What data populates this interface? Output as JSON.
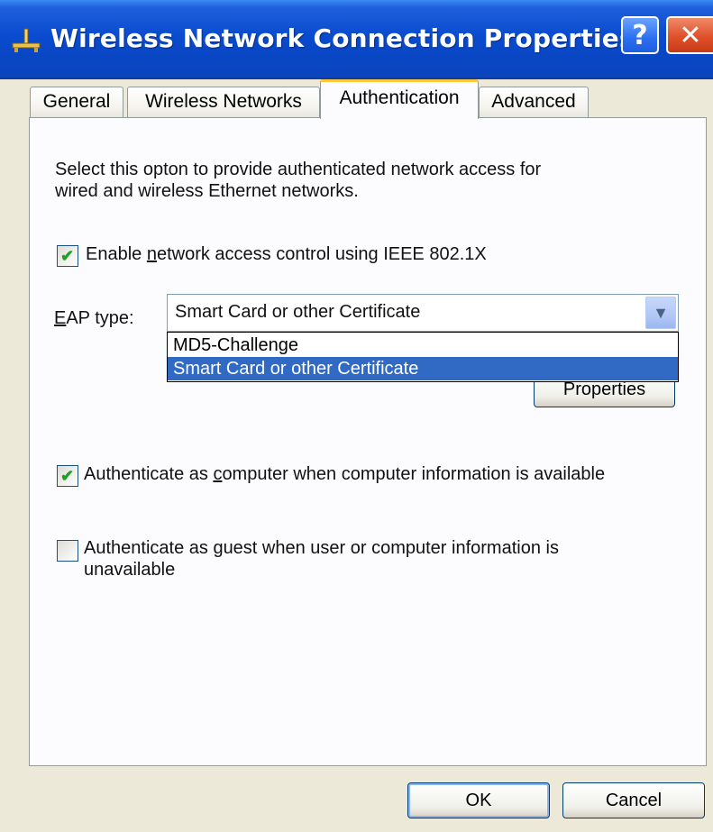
{
  "window": {
    "title": "Wireless Network Connection Properties",
    "icon": "network-connection-icon",
    "help_label": "?",
    "close_label": "✕"
  },
  "tabs": [
    {
      "label": "General",
      "active": false
    },
    {
      "label": "Wireless Networks",
      "active": false
    },
    {
      "label": "Authentication",
      "active": true
    },
    {
      "label": "Advanced",
      "active": false
    }
  ],
  "authentication": {
    "description_line1": "Select this opton to provide authenticated network access for",
    "description_line2": "wired and wireless Ethernet networks.",
    "enable_8021x": {
      "label_before": "Enable ",
      "label_accel": "n",
      "label_after": "etwork access control using IEEE 802.1X",
      "checked": true
    },
    "eap": {
      "label_accel": "E",
      "label_after": "AP type:",
      "selected": "Smart Card or other Certificate",
      "options": [
        "MD5-Challenge",
        "Smart Card or other Certificate"
      ]
    },
    "properties_button": "Properties",
    "auth_as_computer": {
      "label_before": "Authenticate as ",
      "label_accel": "c",
      "label_after": "omputer when computer information is available",
      "checked": true
    },
    "auth_as_guest": {
      "label_before": "Authenticate as ",
      "label_accel": "g",
      "label_after": "uest when user or computer information is unavailable",
      "checked": false
    }
  },
  "buttons": {
    "ok": "OK",
    "cancel": "Cancel"
  },
  "colors": {
    "titlebar": "#0a4ccf",
    "selection": "#316ac5",
    "checkmark": "#21a121",
    "dialog_bg": "#ece9d8"
  }
}
